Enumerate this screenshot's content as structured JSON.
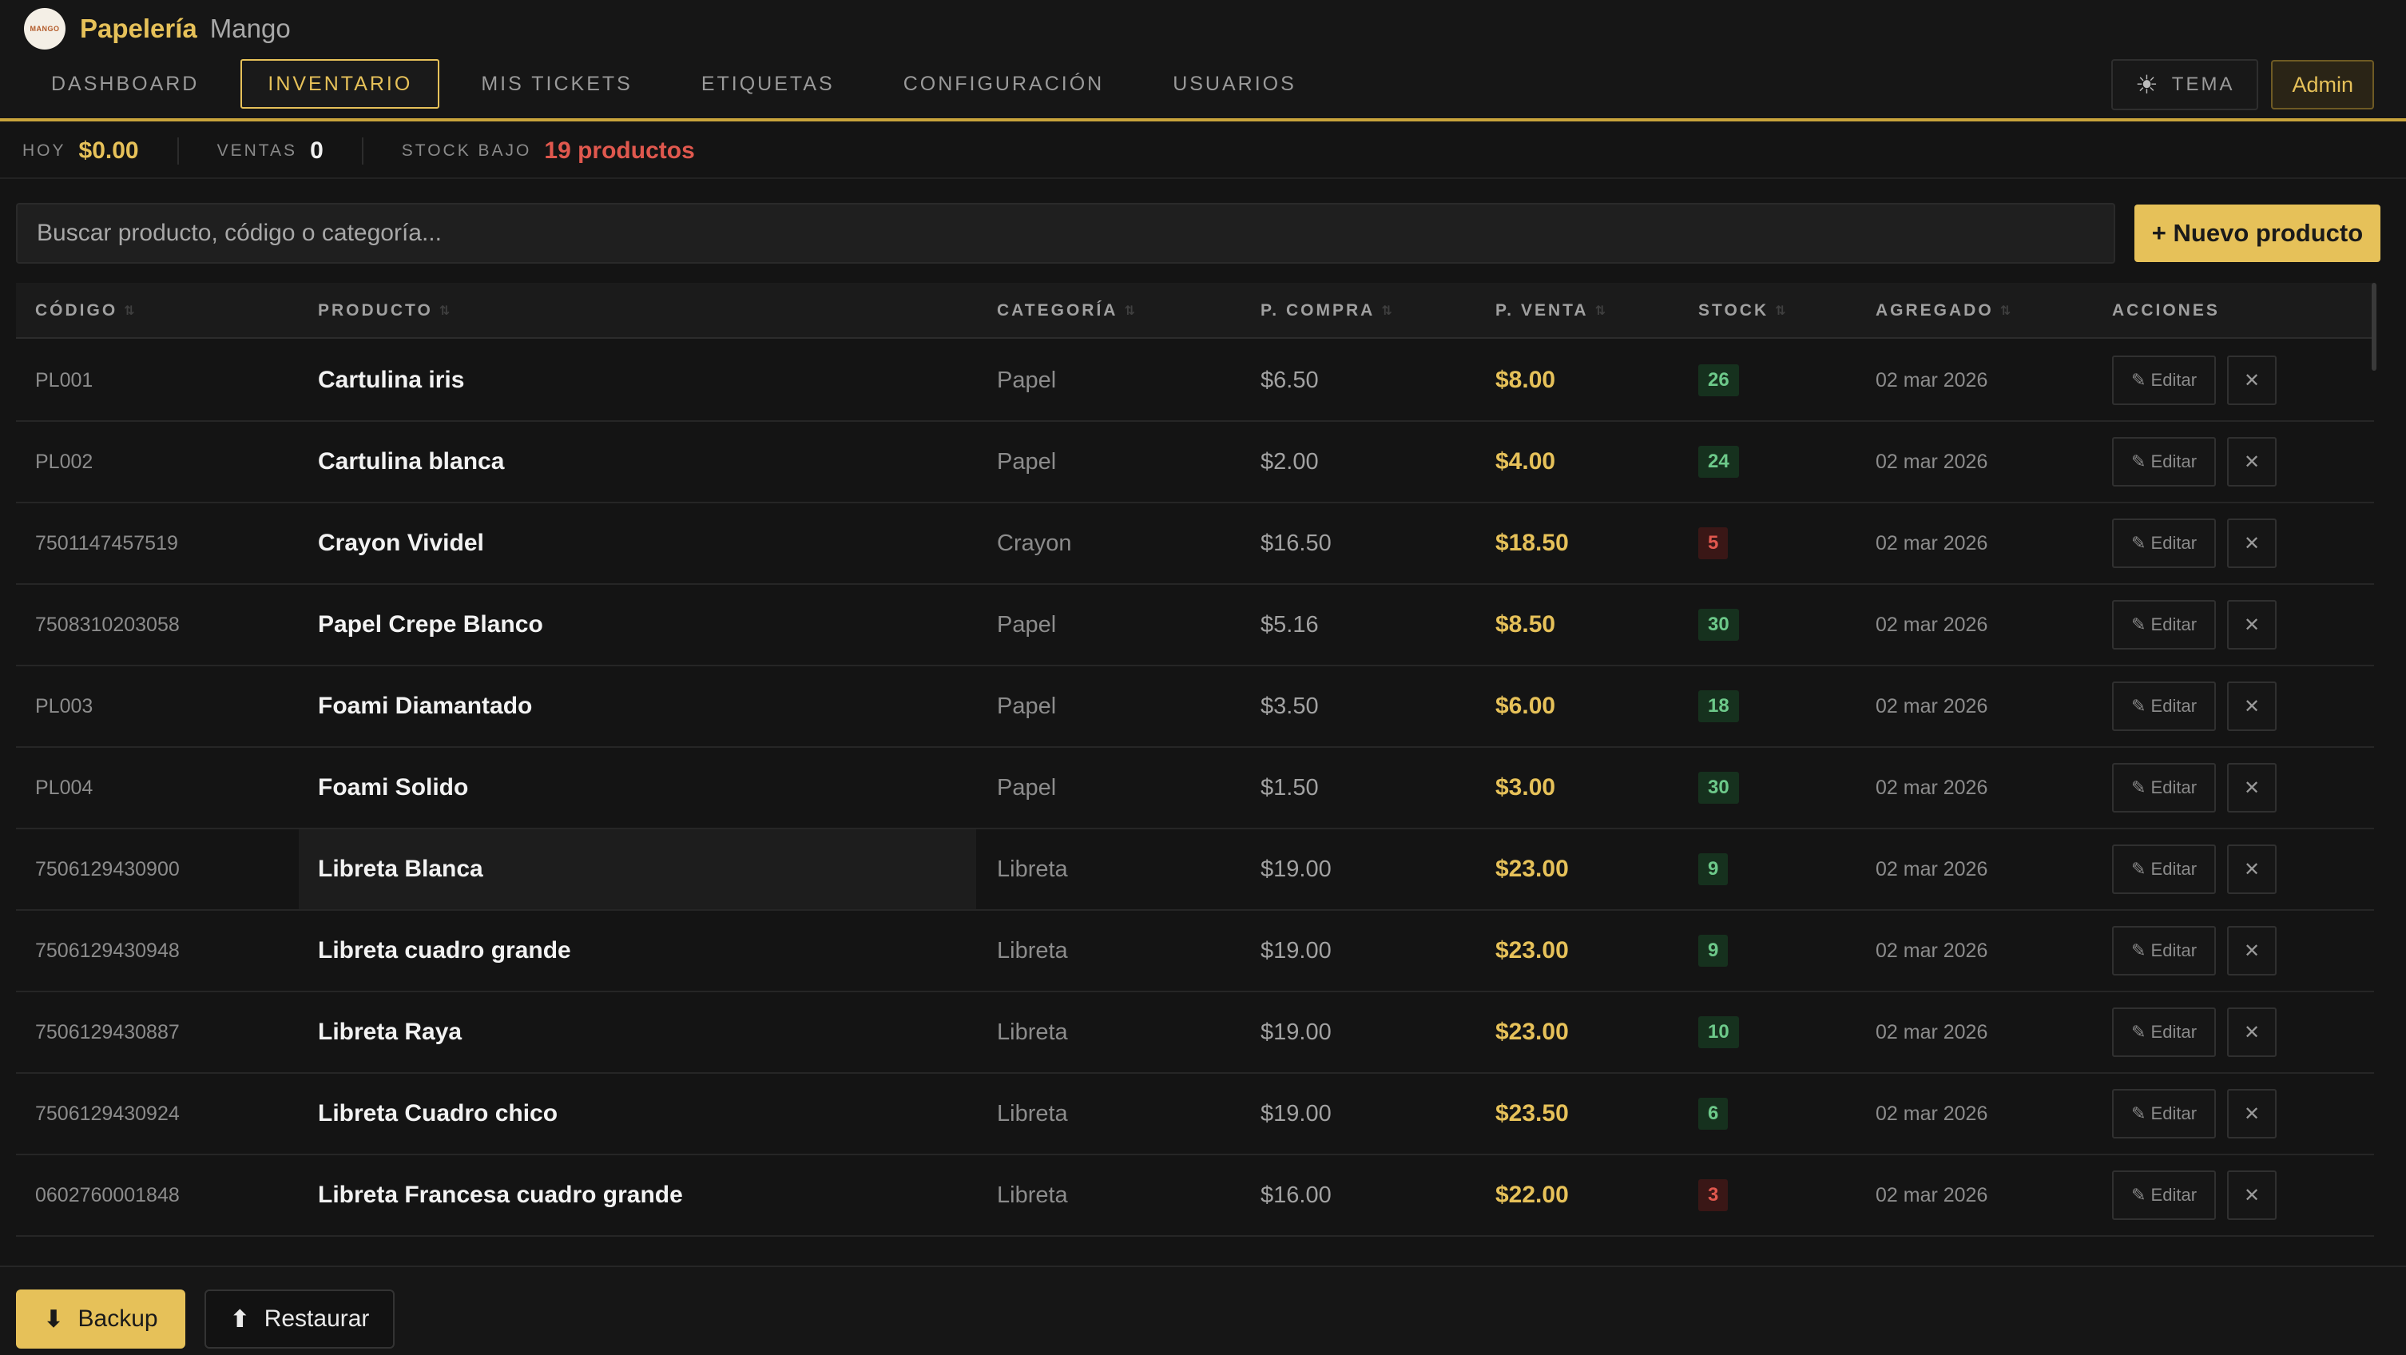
{
  "brand": {
    "name": "Papelería",
    "subtitle": "Mango",
    "logo_text": "MANGO"
  },
  "nav": {
    "tabs": [
      {
        "label": "DASHBOARD",
        "active": false
      },
      {
        "label": "INVENTARIO",
        "active": true
      },
      {
        "label": "MIS TICKETS",
        "active": false
      },
      {
        "label": "ETIQUETAS",
        "active": false
      },
      {
        "label": "CONFIGURACIÓN",
        "active": false
      },
      {
        "label": "USUARIOS",
        "active": false
      }
    ],
    "theme_label": "TEMA",
    "theme_icon": "sun-icon",
    "user_label": "Admin"
  },
  "stats": {
    "today_label": "HOY",
    "today_value": "$0.00",
    "sales_label": "VENTAS",
    "sales_value": "0",
    "low_stock_label": "STOCK BAJO",
    "low_stock_value": "19 productos"
  },
  "search": {
    "placeholder": "Buscar producto, código o categoría...",
    "value": ""
  },
  "new_product_label": "+ Nuevo producto",
  "table": {
    "columns": [
      "CÓDIGO",
      "PRODUCTO",
      "CATEGORÍA",
      "P. COMPRA",
      "P. VENTA",
      "STOCK",
      "AGREGADO",
      "ACCIONES"
    ],
    "edit_label": "✎ Editar",
    "delete_icon": "close-icon",
    "rows": [
      {
        "code": "PL001",
        "name": "Cartulina iris",
        "category": "Papel",
        "buy": "$6.50",
        "sell": "$8.00",
        "stock": "26",
        "low": false,
        "added": "02 mar 2026"
      },
      {
        "code": "PL002",
        "name": "Cartulina blanca",
        "category": "Papel",
        "buy": "$2.00",
        "sell": "$4.00",
        "stock": "24",
        "low": false,
        "added": "02 mar 2026"
      },
      {
        "code": "7501147457519",
        "name": "Crayon Vividel",
        "category": "Crayon",
        "buy": "$16.50",
        "sell": "$18.50",
        "stock": "5",
        "low": true,
        "added": "02 mar 2026"
      },
      {
        "code": "7508310203058",
        "name": "Papel Crepe Blanco",
        "category": "Papel",
        "buy": "$5.16",
        "sell": "$8.50",
        "stock": "30",
        "low": false,
        "added": "02 mar 2026"
      },
      {
        "code": "PL003",
        "name": "Foami Diamantado",
        "category": "Papel",
        "buy": "$3.50",
        "sell": "$6.00",
        "stock": "18",
        "low": false,
        "added": "02 mar 2026"
      },
      {
        "code": "PL004",
        "name": "Foami Solido",
        "category": "Papel",
        "buy": "$1.50",
        "sell": "$3.00",
        "stock": "30",
        "low": false,
        "added": "02 mar 2026"
      },
      {
        "code": "7506129430900",
        "name": "Libreta Blanca",
        "category": "Libreta",
        "buy": "$19.00",
        "sell": "$23.00",
        "stock": "9",
        "low": false,
        "added": "02 mar 2026",
        "hover": true
      },
      {
        "code": "7506129430948",
        "name": "Libreta cuadro grande",
        "category": "Libreta",
        "buy": "$19.00",
        "sell": "$23.00",
        "stock": "9",
        "low": false,
        "added": "02 mar 2026"
      },
      {
        "code": "7506129430887",
        "name": "Libreta Raya",
        "category": "Libreta",
        "buy": "$19.00",
        "sell": "$23.00",
        "stock": "10",
        "low": false,
        "added": "02 mar 2026"
      },
      {
        "code": "7506129430924",
        "name": "Libreta Cuadro chico",
        "category": "Libreta",
        "buy": "$19.00",
        "sell": "$23.50",
        "stock": "6",
        "low": false,
        "added": "02 mar 2026"
      },
      {
        "code": "0602760001848",
        "name": "Libreta Francesa cuadro grande",
        "category": "Libreta",
        "buy": "$16.00",
        "sell": "$22.00",
        "stock": "3",
        "low": true,
        "added": "02 mar 2026"
      }
    ]
  },
  "footer": {
    "backup_label": "Backup",
    "restore_label": "Restaurar"
  },
  "colors": {
    "accent": "#e6c159",
    "danger": "#e0584e",
    "ok": "#6dc98a",
    "background": "#141414"
  }
}
